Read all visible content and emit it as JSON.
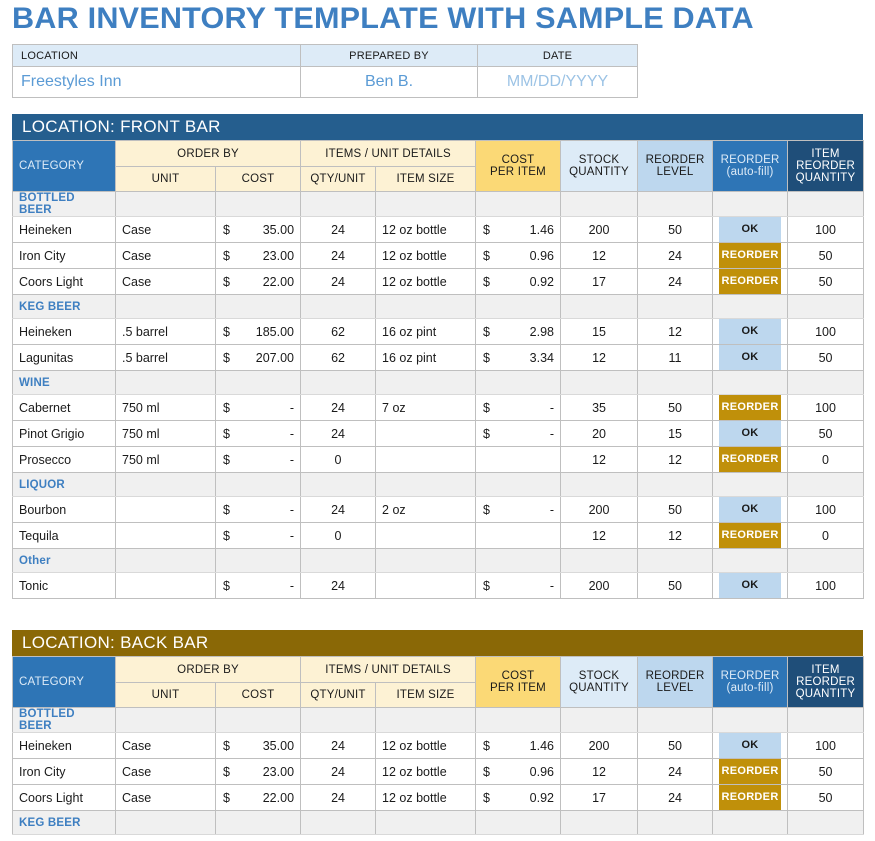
{
  "title": "BAR INVENTORY TEMPLATE WITH SAMPLE DATA",
  "info": {
    "headers": {
      "location": "LOCATION",
      "prepared_by": "PREPARED BY",
      "date": "DATE"
    },
    "values": {
      "location": "Freestyles Inn",
      "prepared_by": "Ben B.",
      "date": "MM/DD/YYYY"
    }
  },
  "columns": {
    "category": "CATEGORY",
    "order_by": "ORDER BY",
    "unit": "UNIT",
    "cost": "COST",
    "items_unit_details": "ITEMS / UNIT DETAILS",
    "qty_unit": "QTY/UNIT",
    "item_size": "ITEM SIZE",
    "cost_per_item_l1": "COST",
    "cost_per_item_l2": "PER ITEM",
    "stock_qty_l1": "STOCK",
    "stock_qty_l2": "QUANTITY",
    "reorder_level_l1": "REORDER",
    "reorder_level_l2": "LEVEL",
    "reorder_auto_l1": "REORDER",
    "reorder_auto_l2": "(auto-fill)",
    "item_reorder_qty_l1": "ITEM",
    "item_reorder_qty_l2": "REORDER",
    "item_reorder_qty_l3": "QUANTITY"
  },
  "colors": {
    "title_blue": "#3E7FC1",
    "front_band": "#255E8E",
    "back_band": "#8A6806",
    "category_header": "#2E75B6",
    "cost_per_item": "#FBD976",
    "reorder_badge": "#C0900A",
    "ok_badge": "#BDD7EE",
    "item_reorder_qty_header": "#1F4E79"
  },
  "blocks": [
    {
      "band": "LOCATION: FRONT BAR",
      "band_style": "front",
      "sections": [
        {
          "name": "BOTTLED BEER",
          "rows": [
            {
              "category": "Heineken",
              "unit": "Case",
              "dollar": "$",
              "cost": "35.00",
              "qty_unit": "24",
              "item_size": "12 oz bottle",
              "pitem_dollar": "$",
              "cost_per_item": "1.46",
              "stock_quantity": "200",
              "reorder_level": "50",
              "flag": "OK",
              "flag_state": "ok",
              "item_reorder_qty": "100"
            },
            {
              "category": "Iron City",
              "unit": "Case",
              "dollar": "$",
              "cost": "23.00",
              "qty_unit": "24",
              "item_size": "12 oz bottle",
              "pitem_dollar": "$",
              "cost_per_item": "0.96",
              "stock_quantity": "12",
              "reorder_level": "24",
              "flag": "REORDER",
              "flag_state": "reorder",
              "item_reorder_qty": "50"
            },
            {
              "category": "Coors Light",
              "unit": "Case",
              "dollar": "$",
              "cost": "22.00",
              "qty_unit": "24",
              "item_size": "12 oz bottle",
              "pitem_dollar": "$",
              "cost_per_item": "0.92",
              "stock_quantity": "17",
              "reorder_level": "24",
              "flag": "REORDER",
              "flag_state": "reorder",
              "item_reorder_qty": "50"
            }
          ]
        },
        {
          "name": "KEG BEER",
          "rows": [
            {
              "category": "Heineken",
              "unit": ".5 barrel",
              "dollar": "$",
              "cost": "185.00",
              "qty_unit": "62",
              "item_size": "16 oz pint",
              "pitem_dollar": "$",
              "cost_per_item": "2.98",
              "stock_quantity": "15",
              "reorder_level": "12",
              "flag": "OK",
              "flag_state": "ok",
              "item_reorder_qty": "100"
            },
            {
              "category": "Lagunitas",
              "unit": ".5 barrel",
              "dollar": "$",
              "cost": "207.00",
              "qty_unit": "62",
              "item_size": "16 oz pint",
              "pitem_dollar": "$",
              "cost_per_item": "3.34",
              "stock_quantity": "12",
              "reorder_level": "11",
              "flag": "OK",
              "flag_state": "ok",
              "item_reorder_qty": "50"
            }
          ]
        },
        {
          "name": "WINE",
          "rows": [
            {
              "category": "Cabernet",
              "unit": "750 ml",
              "dollar": "$",
              "cost": "-",
              "qty_unit": "24",
              "item_size": "7 oz",
              "pitem_dollar": "$",
              "cost_per_item": "-",
              "stock_quantity": "35",
              "reorder_level": "50",
              "flag": "REORDER",
              "flag_state": "reorder",
              "item_reorder_qty": "100"
            },
            {
              "category": "Pinot Grigio",
              "unit": "750 ml",
              "dollar": "$",
              "cost": "-",
              "qty_unit": "24",
              "item_size": "",
              "pitem_dollar": "$",
              "cost_per_item": "-",
              "stock_quantity": "20",
              "reorder_level": "15",
              "flag": "OK",
              "flag_state": "ok",
              "item_reorder_qty": "50"
            },
            {
              "category": "Prosecco",
              "unit": "750 ml",
              "dollar": "$",
              "cost": "-",
              "qty_unit": "0",
              "item_size": "",
              "pitem_dollar": "",
              "cost_per_item": "",
              "stock_quantity": "12",
              "reorder_level": "12",
              "flag": "REORDER",
              "flag_state": "reorder",
              "item_reorder_qty": "0"
            }
          ]
        },
        {
          "name": "LIQUOR",
          "rows": [
            {
              "category": "Bourbon",
              "unit": "",
              "dollar": "$",
              "cost": "-",
              "qty_unit": "24",
              "item_size": "2 oz",
              "pitem_dollar": "$",
              "cost_per_item": "-",
              "stock_quantity": "200",
              "reorder_level": "50",
              "flag": "OK",
              "flag_state": "ok",
              "item_reorder_qty": "100"
            },
            {
              "category": "Tequila",
              "unit": "",
              "dollar": "$",
              "cost": "-",
              "qty_unit": "0",
              "item_size": "",
              "pitem_dollar": "",
              "cost_per_item": "",
              "stock_quantity": "12",
              "reorder_level": "12",
              "flag": "REORDER",
              "flag_state": "reorder",
              "item_reorder_qty": "0"
            }
          ]
        },
        {
          "name": "Other",
          "rows": [
            {
              "category": "Tonic",
              "unit": "",
              "dollar": "$",
              "cost": "-",
              "qty_unit": "24",
              "item_size": "",
              "pitem_dollar": "$",
              "cost_per_item": "-",
              "stock_quantity": "200",
              "reorder_level": "50",
              "flag": "OK",
              "flag_state": "ok",
              "item_reorder_qty": "100"
            }
          ]
        }
      ]
    },
    {
      "band": "LOCATION: BACK BAR",
      "band_style": "back",
      "sections": [
        {
          "name": "BOTTLED BEER",
          "rows": [
            {
              "category": "Heineken",
              "unit": "Case",
              "dollar": "$",
              "cost": "35.00",
              "qty_unit": "24",
              "item_size": "12 oz bottle",
              "pitem_dollar": "$",
              "cost_per_item": "1.46",
              "stock_quantity": "200",
              "reorder_level": "50",
              "flag": "OK",
              "flag_state": "ok",
              "item_reorder_qty": "100"
            },
            {
              "category": "Iron City",
              "unit": "Case",
              "dollar": "$",
              "cost": "23.00",
              "qty_unit": "24",
              "item_size": "12 oz bottle",
              "pitem_dollar": "$",
              "cost_per_item": "0.96",
              "stock_quantity": "12",
              "reorder_level": "24",
              "flag": "REORDER",
              "flag_state": "reorder",
              "item_reorder_qty": "50"
            },
            {
              "category": "Coors Light",
              "unit": "Case",
              "dollar": "$",
              "cost": "22.00",
              "qty_unit": "24",
              "item_size": "12 oz bottle",
              "pitem_dollar": "$",
              "cost_per_item": "0.92",
              "stock_quantity": "17",
              "reorder_level": "24",
              "flag": "REORDER",
              "flag_state": "reorder",
              "item_reorder_qty": "50"
            }
          ]
        },
        {
          "name": "KEG BEER",
          "rows": []
        }
      ]
    }
  ]
}
